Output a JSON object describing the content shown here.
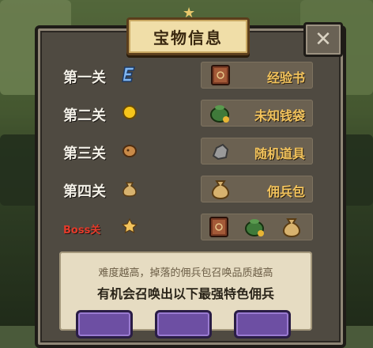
{
  "dialog": {
    "title": "宝物信息",
    "close_label": "✕"
  },
  "rows": [
    {
      "stage": "第一关",
      "stage_icon": "e-rank-icon",
      "rewards": [
        "book-icon"
      ],
      "reward_label": "经验书"
    },
    {
      "stage": "第二关",
      "stage_icon": "gold-coin-icon",
      "rewards": [
        "pouch-icon"
      ],
      "reward_label": "未知钱袋"
    },
    {
      "stage": "第三关",
      "stage_icon": "cookie-icon",
      "rewards": [
        "rock-icon"
      ],
      "reward_label": "随机道具"
    },
    {
      "stage": "第四关",
      "stage_icon": "sack-icon",
      "rewards": [
        "sack-icon"
      ],
      "reward_label": "佣兵包"
    },
    {
      "stage": "Boss关",
      "stage_icon": "star-icon",
      "rewards": [
        "book-icon",
        "pouch-icon",
        "sack-icon"
      ],
      "reward_label": ""
    }
  ],
  "info": {
    "line1": "难度越高，掉落的佣兵包召唤品质越高",
    "line2": "有机会召唤出以下最强特色佣兵"
  },
  "colors": {
    "reward_text": "#f2c35c",
    "boss_stage": "#e53a2a",
    "slot": "#6d4fa3"
  }
}
